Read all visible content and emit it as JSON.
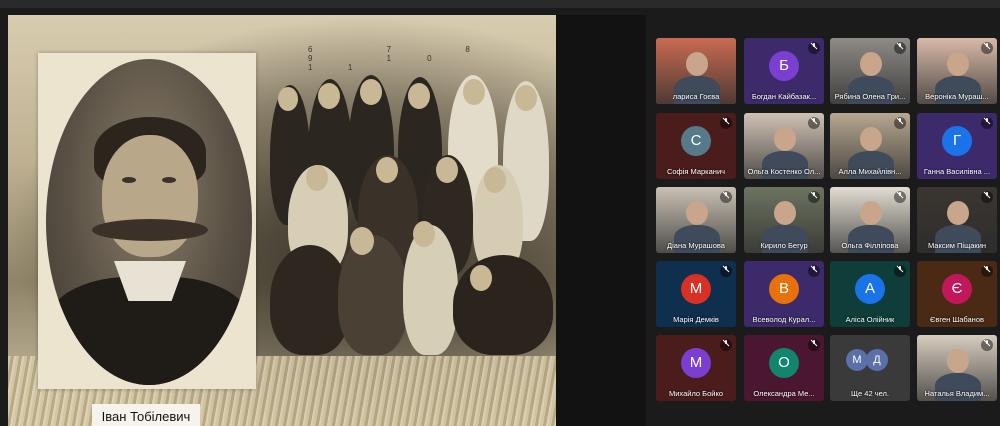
{
  "presentation": {
    "caption": "Іван Тобілевич",
    "photo_numbers": "6 7 8 9 10 11"
  },
  "participants": [
    {
      "name": "лариса Гоєва",
      "type": "video",
      "active": true,
      "muted": false,
      "bg": "#c96b52"
    },
    {
      "name": "Богдан Кайбазак...",
      "type": "avatar",
      "initial": "Б",
      "avatar_color": "#7a3fd0",
      "muted": true
    },
    {
      "name": "Рябина Олена Гри...",
      "type": "video",
      "muted": true,
      "bg": "#8e8a86"
    },
    {
      "name": "Вероніка Мураш...",
      "type": "video",
      "muted": true,
      "bg": "#d9b9a8"
    },
    {
      "name": "Софія Марканич",
      "type": "avatar",
      "initial": "С",
      "avatar_color": "#557a8a",
      "muted": true
    },
    {
      "name": "Ольга Костенко Ол...",
      "type": "video",
      "muted": true,
      "bg": "#cfc2b5"
    },
    {
      "name": "Алла Михайлівн...",
      "type": "video",
      "muted": true,
      "bg": "#b6a790"
    },
    {
      "name": "Ганна Василівна ...",
      "type": "avatar",
      "initial": "Г",
      "avatar_color": "#1a73e8",
      "muted": true
    },
    {
      "name": "Діана Мурашова",
      "type": "video",
      "muted": true,
      "bg": "#c9c1b4"
    },
    {
      "name": "Кирило Бегур",
      "type": "video",
      "muted": true,
      "bg": "#6c7460"
    },
    {
      "name": "Ольга Філліпова",
      "type": "video",
      "muted": true,
      "bg": "#e2ddd2"
    },
    {
      "name": "Максим Піщакин",
      "type": "video",
      "muted": true,
      "bg": "#3a3530"
    },
    {
      "name": "Марія Демків",
      "type": "avatar",
      "initial": "М",
      "avatar_color": "#d93025",
      "muted": true
    },
    {
      "name": "Всеволод Курал...",
      "type": "avatar",
      "initial": "В",
      "avatar_color": "#e8710a",
      "muted": true
    },
    {
      "name": "Аліса Олійник",
      "type": "avatar",
      "initial": "А",
      "avatar_color": "#1a73e8",
      "muted": true
    },
    {
      "name": "Євген Шабанов",
      "type": "avatar",
      "initial": "Є",
      "avatar_color": "#c2185b",
      "muted": true
    },
    {
      "name": "Михайло Бойко",
      "type": "avatar",
      "initial": "М",
      "avatar_color": "#7a3fd0",
      "muted": true
    },
    {
      "name": "Олександра Ме...",
      "type": "avatar",
      "initial": "О",
      "avatar_color": "#12856f",
      "muted": true
    },
    {
      "name": "Ще 42 чел.",
      "type": "more",
      "initials": [
        "М",
        "Д"
      ],
      "muted": false
    },
    {
      "name": "Наталья Владим...",
      "type": "video",
      "muted": true,
      "bg": "#d7cdbf"
    }
  ],
  "colors": {
    "tile_bg_blue": "#0f2f4f",
    "tile_bg_purple": "#3c2a6b",
    "tile_bg_teal": "#0e3d3a",
    "tile_bg_orange": "#4a2a14",
    "tile_bg_red": "#4a1c1c",
    "tile_bg_pink": "#4a1630",
    "mic_off_icon": "mic-off-icon"
  }
}
